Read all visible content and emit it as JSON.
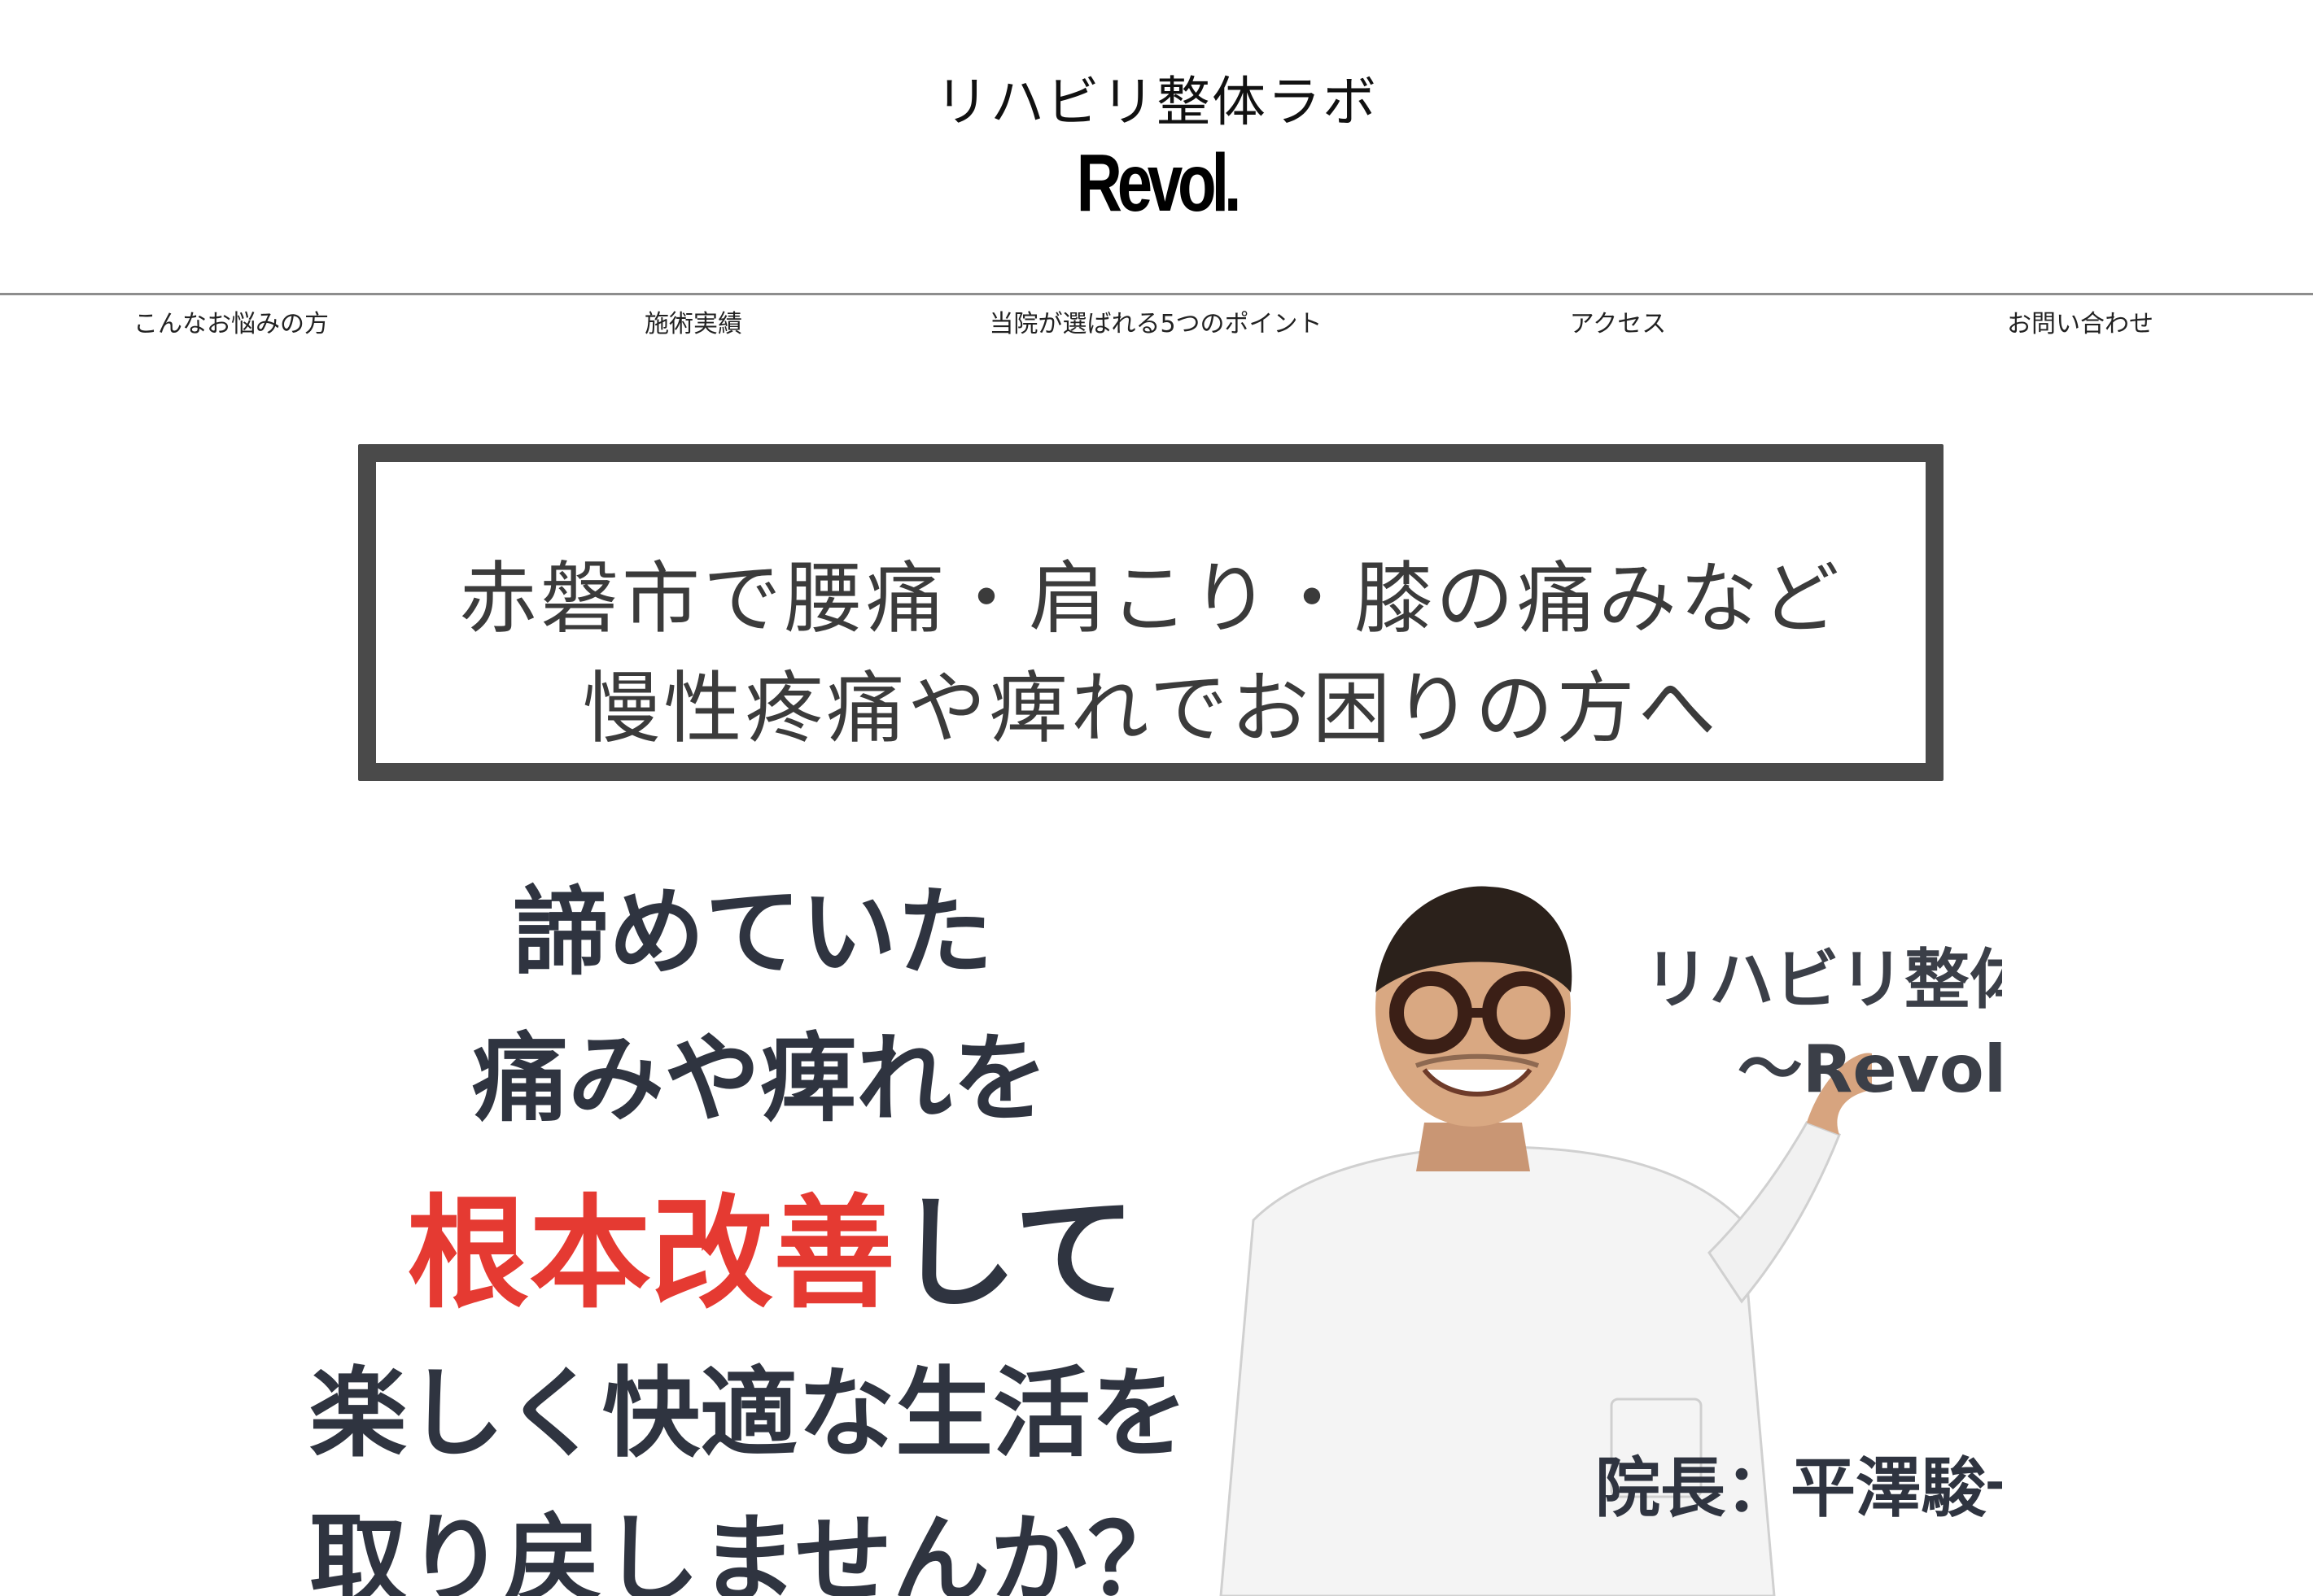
{
  "header": {
    "subtitle": "リハビリ整体ラボ",
    "logo": "Revol."
  },
  "nav": {
    "items": [
      {
        "label": "こんなお悩みの方"
      },
      {
        "label": "施術実績"
      },
      {
        "label": "当院が選ばれる5つのポイント"
      },
      {
        "label": "アクセス"
      },
      {
        "label": "お問い合わせ"
      }
    ]
  },
  "hero": {
    "box_line1": "赤磐市で腰痛・肩こり・膝の痛みなど",
    "box_line2": "慢性疼痛や痺れでお困りの方へ",
    "line1": "諦めていた",
    "line2": "痛みや痺れを",
    "line3_accent": "根本改善",
    "line3_rest": "して",
    "line4": "楽しく快適な生活を",
    "line5": "取り戻しませんか？",
    "right_title": "リハビリ整体ラボ",
    "right_subtitle": "～Revol～",
    "director": "院長：平澤駿一",
    "accent_color": "#e53a32",
    "text_color": "#2f3440"
  }
}
